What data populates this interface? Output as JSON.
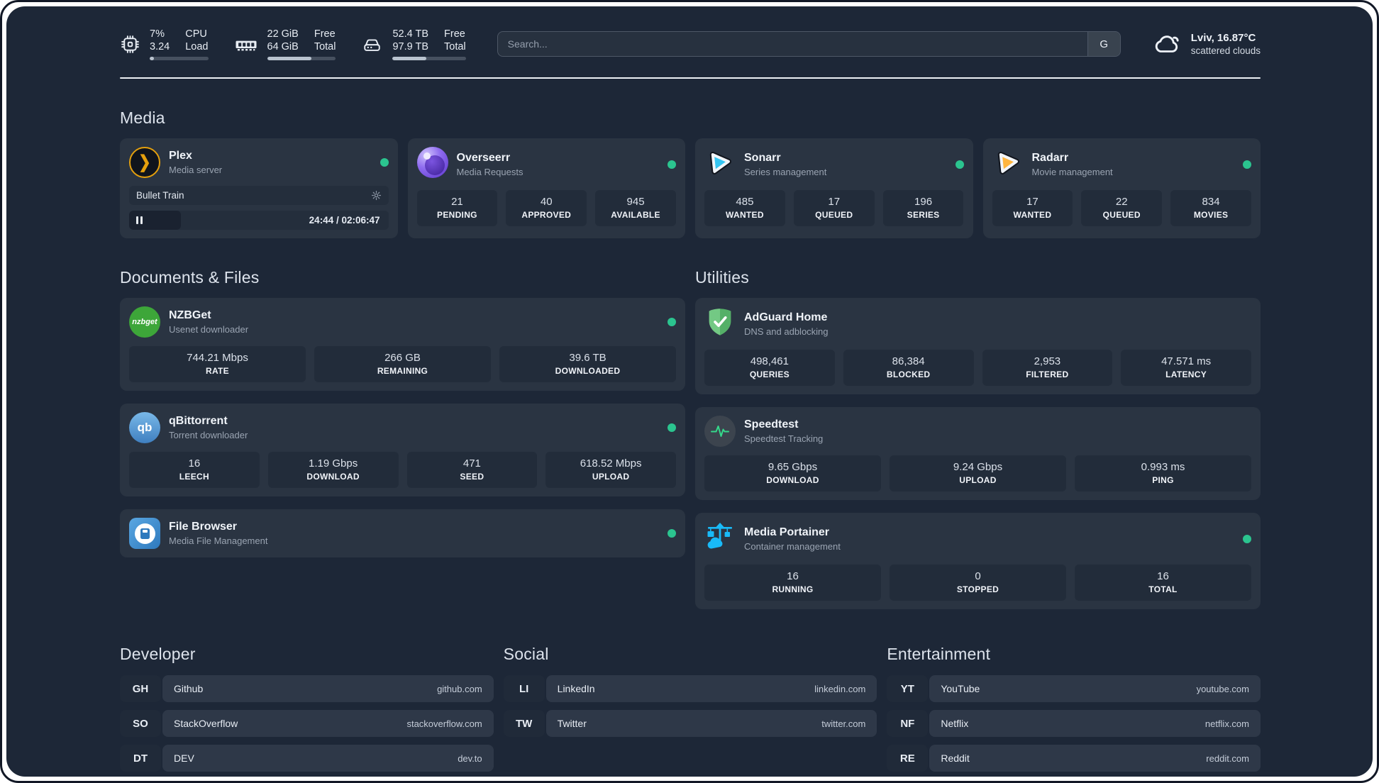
{
  "header": {
    "system_stats": [
      {
        "id": "cpu",
        "icon": "cpu-icon",
        "values": [
          "7%",
          "3.24"
        ],
        "labels": [
          "CPU",
          "Load"
        ],
        "usage_pct": 7
      },
      {
        "id": "memory",
        "icon": "ram-icon",
        "values": [
          "22 GiB",
          "64 GiB"
        ],
        "labels": [
          "Free",
          "Total"
        ],
        "usage_pct": 64
      },
      {
        "id": "storage",
        "icon": "disk-icon",
        "values": [
          "52.4 TB",
          "97.9 TB"
        ],
        "labels": [
          "Free",
          "Total"
        ],
        "usage_pct": 46
      }
    ],
    "search": {
      "placeholder": "Search...",
      "engine_button": "G"
    },
    "weather": {
      "location": "Lviv, 16.87°C",
      "condition": "scattered clouds"
    }
  },
  "sections": {
    "media": {
      "title": "Media",
      "apps": [
        {
          "id": "plex",
          "icon": "plex",
          "name": "Plex",
          "desc": "Media server",
          "online": true,
          "player": {
            "title": "Bullet Train",
            "time": "24:44 / 02:06:47",
            "progress_pct": 20
          }
        },
        {
          "id": "overseerr",
          "icon": "overseerr",
          "name": "Overseerr",
          "desc": "Media Requests",
          "online": true,
          "stats": [
            {
              "value": "21",
              "label": "PENDING"
            },
            {
              "value": "40",
              "label": "APPROVED"
            },
            {
              "value": "945",
              "label": "AVAILABLE"
            }
          ]
        },
        {
          "id": "sonarr",
          "icon": "sonarr",
          "name": "Sonarr",
          "desc": "Series management",
          "online": true,
          "stats": [
            {
              "value": "485",
              "label": "WANTED"
            },
            {
              "value": "17",
              "label": "QUEUED"
            },
            {
              "value": "196",
              "label": "SERIES"
            }
          ]
        },
        {
          "id": "radarr",
          "icon": "radarr",
          "name": "Radarr",
          "desc": "Movie management",
          "online": true,
          "stats": [
            {
              "value": "17",
              "label": "WANTED"
            },
            {
              "value": "22",
              "label": "QUEUED"
            },
            {
              "value": "834",
              "label": "MOVIES"
            }
          ]
        }
      ]
    },
    "documents": {
      "title": "Documents & Files",
      "apps": [
        {
          "id": "nzbget",
          "icon": "nzbget",
          "name": "NZBGet",
          "desc": "Usenet downloader",
          "online": true,
          "stats": [
            {
              "value": "744.21 Mbps",
              "label": "RATE"
            },
            {
              "value": "266 GB",
              "label": "REMAINING"
            },
            {
              "value": "39.6 TB",
              "label": "DOWNLOADED"
            }
          ]
        },
        {
          "id": "qbittorrent",
          "icon": "qbittorrent",
          "name": "qBittorrent",
          "desc": "Torrent downloader",
          "online": true,
          "stats": [
            {
              "value": "16",
              "label": "LEECH"
            },
            {
              "value": "1.19 Gbps",
              "label": "DOWNLOAD"
            },
            {
              "value": "471",
              "label": "SEED"
            },
            {
              "value": "618.52 Mbps",
              "label": "UPLOAD"
            }
          ]
        },
        {
          "id": "filebrowser",
          "icon": "filebrowser",
          "name": "File Browser",
          "desc": "Media File Management",
          "online": true
        }
      ]
    },
    "utilities": {
      "title": "Utilities",
      "apps": [
        {
          "id": "adguard",
          "icon": "adguard",
          "name": "AdGuard Home",
          "desc": "DNS and adblocking",
          "online": false,
          "stats": [
            {
              "value": "498,461",
              "label": "QUERIES"
            },
            {
              "value": "86,384",
              "label": "BLOCKED"
            },
            {
              "value": "2,953",
              "label": "FILTERED"
            },
            {
              "value": "47.571 ms",
              "label": "LATENCY"
            }
          ]
        },
        {
          "id": "speedtest",
          "icon": "speedtest",
          "name": "Speedtest",
          "desc": "Speedtest Tracking",
          "online": false,
          "stats": [
            {
              "value": "9.65 Gbps",
              "label": "DOWNLOAD"
            },
            {
              "value": "9.24 Gbps",
              "label": "UPLOAD"
            },
            {
              "value": "0.993 ms",
              "label": "PING"
            }
          ]
        },
        {
          "id": "portainer",
          "icon": "portainer",
          "name": "Media Portainer",
          "desc": "Container management",
          "online": true,
          "stats": [
            {
              "value": "16",
              "label": "RUNNING"
            },
            {
              "value": "0",
              "label": "STOPPED"
            },
            {
              "value": "16",
              "label": "TOTAL"
            }
          ]
        }
      ]
    }
  },
  "bookmarks": [
    {
      "title": "Developer",
      "links": [
        {
          "abbr": "GH",
          "name": "Github",
          "url": "github.com"
        },
        {
          "abbr": "SO",
          "name": "StackOverflow",
          "url": "stackoverflow.com"
        },
        {
          "abbr": "DT",
          "name": "DEV",
          "url": "dev.to"
        }
      ]
    },
    {
      "title": "Social",
      "links": [
        {
          "abbr": "LI",
          "name": "LinkedIn",
          "url": "linkedin.com"
        },
        {
          "abbr": "TW",
          "name": "Twitter",
          "url": "twitter.com"
        }
      ]
    },
    {
      "title": "Entertainment",
      "links": [
        {
          "abbr": "YT",
          "name": "YouTube",
          "url": "youtube.com"
        },
        {
          "abbr": "NF",
          "name": "Netflix",
          "url": "netflix.com"
        },
        {
          "abbr": "RE",
          "name": "Reddit",
          "url": "reddit.com"
        }
      ]
    }
  ],
  "colors": {
    "online": "#2bc48f",
    "plex_accent": "#e5a00d",
    "sonarr_accent": "#35c5f1",
    "radarr_accent": "#ffb53e",
    "portainer_accent": "#19baf8",
    "adguard_accent": "#5fbd72",
    "background": "#1d2737",
    "card": "#2a3442"
  }
}
